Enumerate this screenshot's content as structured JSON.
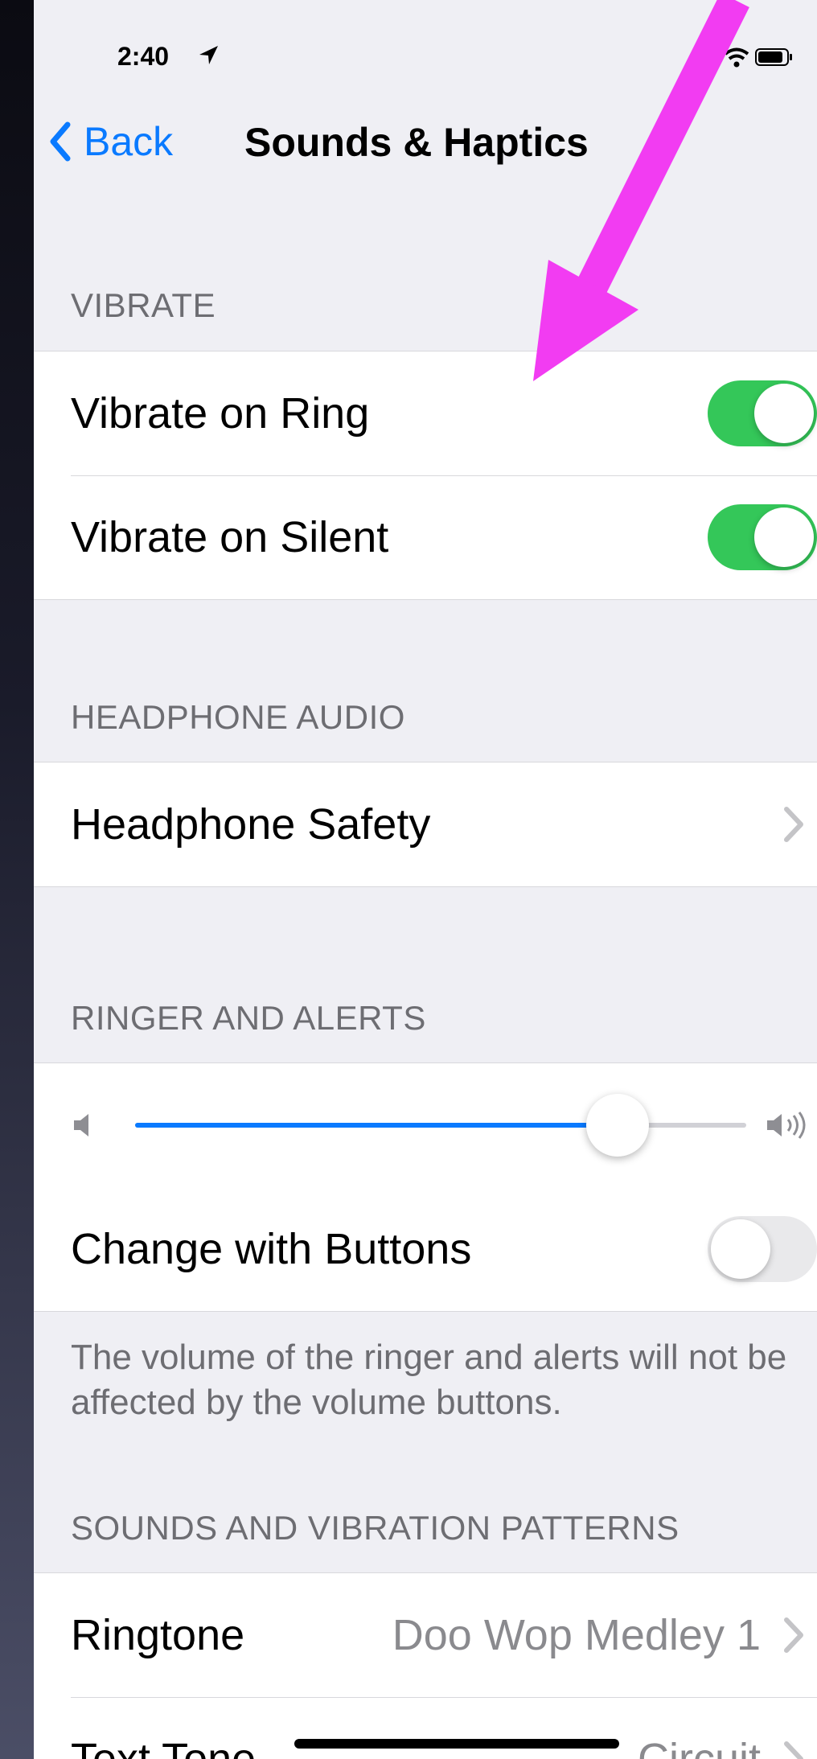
{
  "status_bar": {
    "time": "2:40"
  },
  "nav": {
    "back_label": "Back",
    "title": "Sounds & Haptics"
  },
  "sections": {
    "vibrate": {
      "header": "VIBRATE",
      "rows": [
        {
          "label": "Vibrate on Ring",
          "toggle_on": true
        },
        {
          "label": "Vibrate on Silent",
          "toggle_on": true
        }
      ]
    },
    "headphone_audio": {
      "header": "HEADPHONE AUDIO",
      "rows": [
        {
          "label": "Headphone Safety"
        }
      ]
    },
    "ringer_and_alerts": {
      "header": "RINGER AND ALERTS",
      "volume_level": 0.79,
      "change_with_buttons": {
        "label": "Change with Buttons",
        "toggle_on": false
      },
      "footer": "The volume of the ringer and alerts will not be affected by the volume buttons."
    },
    "sounds_and_vibration": {
      "header": "SOUNDS AND VIBRATION PATTERNS",
      "rows": [
        {
          "label": "Ringtone",
          "value": "Doo Wop Medley 1"
        },
        {
          "label": "Text Tone",
          "value": "Circuit"
        }
      ]
    }
  },
  "colors": {
    "accent": "#0a7aff",
    "toggle_on": "#34c759",
    "annotation_arrow": "#f23cf2"
  },
  "icons": {
    "location": "location-arrow-icon",
    "chevron": "chevron-right-icon",
    "volume_low": "speaker-low-icon",
    "volume_high": "speaker-high-icon"
  }
}
